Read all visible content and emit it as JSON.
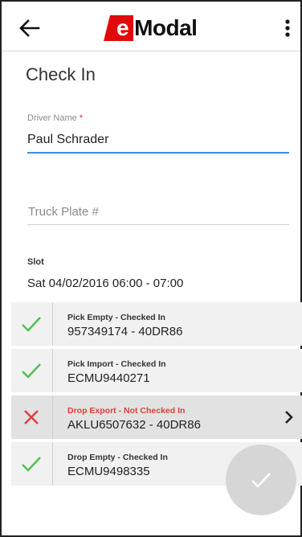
{
  "header": {
    "logo_e": "e",
    "logo_rest": "Modal",
    "back_icon": "arrow-left-icon",
    "menu_icon": "more-vertical-icon"
  },
  "page": {
    "title": "Check In"
  },
  "driver": {
    "label": "Driver Name",
    "required_mark": "*",
    "value": "Paul Schrader"
  },
  "truck_plate": {
    "placeholder": "Truck Plate #",
    "value": ""
  },
  "slot": {
    "label": "Slot",
    "value": "Sat 04/02/2016 06:00 - 07:00"
  },
  "moves": [
    {
      "title": "Pick Empty - Checked In",
      "detail": "957349174 - 40DR86",
      "status": "checked-in"
    },
    {
      "title": "Pick Import - Checked In",
      "detail": "ECMU9440271",
      "status": "checked-in"
    },
    {
      "title": "Drop Export - Not Checked In",
      "detail": "AKLU6507632 - 40DR86",
      "status": "not-checked-in"
    },
    {
      "title": "Drop Empty - Checked In",
      "detail": "ECMU9498335",
      "status": "checked-in"
    }
  ],
  "colors": {
    "logo_red": "#e10a0a",
    "check_green": "#4cc24c",
    "cross_red": "#e23b3b",
    "focus_blue": "#3a8ee6"
  }
}
